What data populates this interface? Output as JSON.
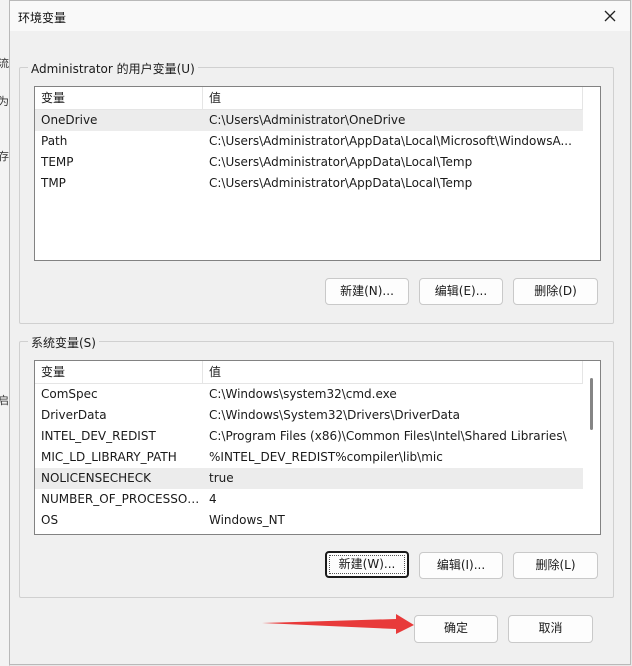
{
  "background": {
    "glyphs": [
      "流",
      "为",
      "存",
      "启"
    ]
  },
  "dialog": {
    "title": "环境变量",
    "close_icon": "close-icon"
  },
  "user_vars": {
    "legend": "Administrator 的用户变量(U)",
    "columns": [
      "变量",
      "值"
    ],
    "rows": [
      {
        "name": "OneDrive",
        "value": "C:\\Users\\Administrator\\OneDrive",
        "selected": true
      },
      {
        "name": "Path",
        "value": "C:\\Users\\Administrator\\AppData\\Local\\Microsoft\\WindowsA...",
        "selected": false
      },
      {
        "name": "TEMP",
        "value": "C:\\Users\\Administrator\\AppData\\Local\\Temp",
        "selected": false
      },
      {
        "name": "TMP",
        "value": "C:\\Users\\Administrator\\AppData\\Local\\Temp",
        "selected": false
      }
    ],
    "buttons": {
      "new": "新建(N)...",
      "edit": "编辑(E)...",
      "delete": "删除(D)"
    }
  },
  "system_vars": {
    "legend": "系统变量(S)",
    "columns": [
      "变量",
      "值"
    ],
    "rows": [
      {
        "name": "ComSpec",
        "value": "C:\\Windows\\system32\\cmd.exe",
        "selected": false
      },
      {
        "name": "DriverData",
        "value": "C:\\Windows\\System32\\Drivers\\DriverData",
        "selected": false
      },
      {
        "name": "INTEL_DEV_REDIST",
        "value": "C:\\Program Files (x86)\\Common Files\\Intel\\Shared Libraries\\",
        "selected": false
      },
      {
        "name": "MIC_LD_LIBRARY_PATH",
        "value": "%INTEL_DEV_REDIST%compiler\\lib\\mic",
        "selected": false
      },
      {
        "name": "NOLICENSECHECK",
        "value": "true",
        "selected": true
      },
      {
        "name": "NUMBER_OF_PROCESSORS",
        "value": "4",
        "selected": false
      },
      {
        "name": "OS",
        "value": "Windows_NT",
        "selected": false
      }
    ],
    "buttons": {
      "new": "新建(W)...",
      "edit": "编辑(I)...",
      "delete": "删除(L)"
    }
  },
  "footer": {
    "ok": "确定",
    "cancel": "取消"
  },
  "colors": {
    "annotation_arrow": "#e83a3a",
    "selection": "#ececec"
  }
}
